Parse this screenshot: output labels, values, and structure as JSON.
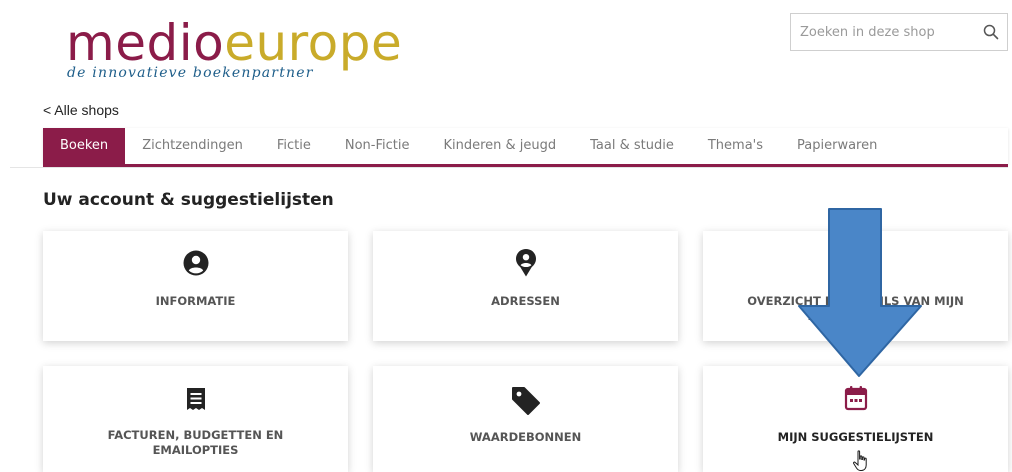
{
  "logo": {
    "part1": "medio",
    "part2": "europe",
    "tagline": "de innovatieve boekenpartner"
  },
  "search": {
    "placeholder": "Zoeken in deze shop",
    "value": ""
  },
  "back_link": "< Alle shops",
  "nav": {
    "tabs": [
      {
        "label": "Boeken",
        "active": true
      },
      {
        "label": "Zichtzendingen"
      },
      {
        "label": "Fictie"
      },
      {
        "label": "Non-Fictie"
      },
      {
        "label": "Kinderen & jeugd"
      },
      {
        "label": "Taal & studie"
      },
      {
        "label": "Thema's"
      },
      {
        "label": "Papierwaren"
      }
    ]
  },
  "section_title": "Uw account & suggestielijsten",
  "cards": [
    {
      "label": "Informatie",
      "icon": "user-circle-icon"
    },
    {
      "label": "Adressen",
      "icon": "map-marker-icon"
    },
    {
      "label": "Overzicht en details van mijn bestellingen",
      "icon": "none"
    },
    {
      "label": "Facturen, budgetten en emailopties",
      "icon": "receipt-icon"
    },
    {
      "label": "Waardebonnen",
      "icon": "tag-icon"
    },
    {
      "label": "Mijn suggestielijsten",
      "icon": "calendar-icon"
    }
  ],
  "colors": {
    "brand": "#8b1c49",
    "logo_gold": "#c9ab2a",
    "tagline": "#1e5e8a",
    "arrow": "#4a86c8"
  },
  "overlay": {
    "arrow": "down-arrow-annotation",
    "cursor": "hand-cursor"
  }
}
